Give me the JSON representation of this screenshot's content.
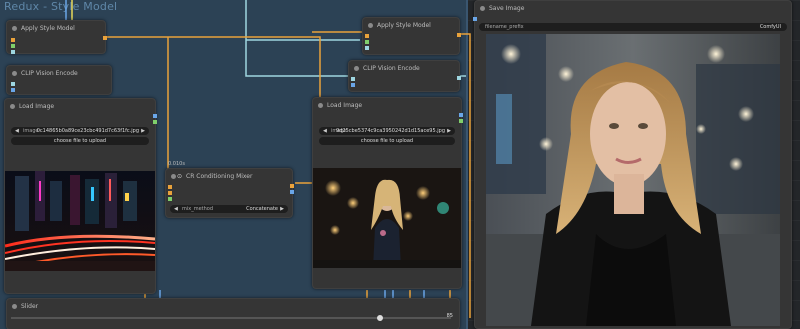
{
  "group": {
    "title": "Redux - Style Model"
  },
  "nodes": {
    "apply_style_1": {
      "title": "Apply Style Model"
    },
    "apply_style_2": {
      "title": "Apply Style Model"
    },
    "clip_vision_1": {
      "title": "CLIP Vision Encode"
    },
    "clip_vision_2": {
      "title": "CLIP Vision Encode"
    },
    "load_image_1": {
      "title": "Load Image",
      "image_label": "image",
      "image_value": "0c14865b0a89ce23cbc491d7c63f1fc.jpg",
      "upload_label": "choose file to upload"
    },
    "load_image_2": {
      "title": "Load Image",
      "image_label": "image",
      "image_value": "9d25cbe5374c9ca3950242d1d15ace95.jpg",
      "upload_label": "choose file to upload"
    },
    "mixer": {
      "badge": "0.010s",
      "title": "CR Conditioning Mixer",
      "method_label": "mix_method",
      "method_value": "Concatenate"
    },
    "save_image": {
      "title": "Save Image",
      "prefix_label": "filename_prefix",
      "prefix_value": "ComfyUI"
    },
    "slider": {
      "title": "Slider",
      "value": "85",
      "level": 0.85
    }
  },
  "colors": {
    "wire_orange": "#e9a23b",
    "wire_cyan": "#9ed6e0",
    "wire_yellow": "#e8d95a",
    "wire_blue": "#6aa6e8",
    "wire_green": "#7fcf6b",
    "wire_pink": "#d96ad1"
  }
}
